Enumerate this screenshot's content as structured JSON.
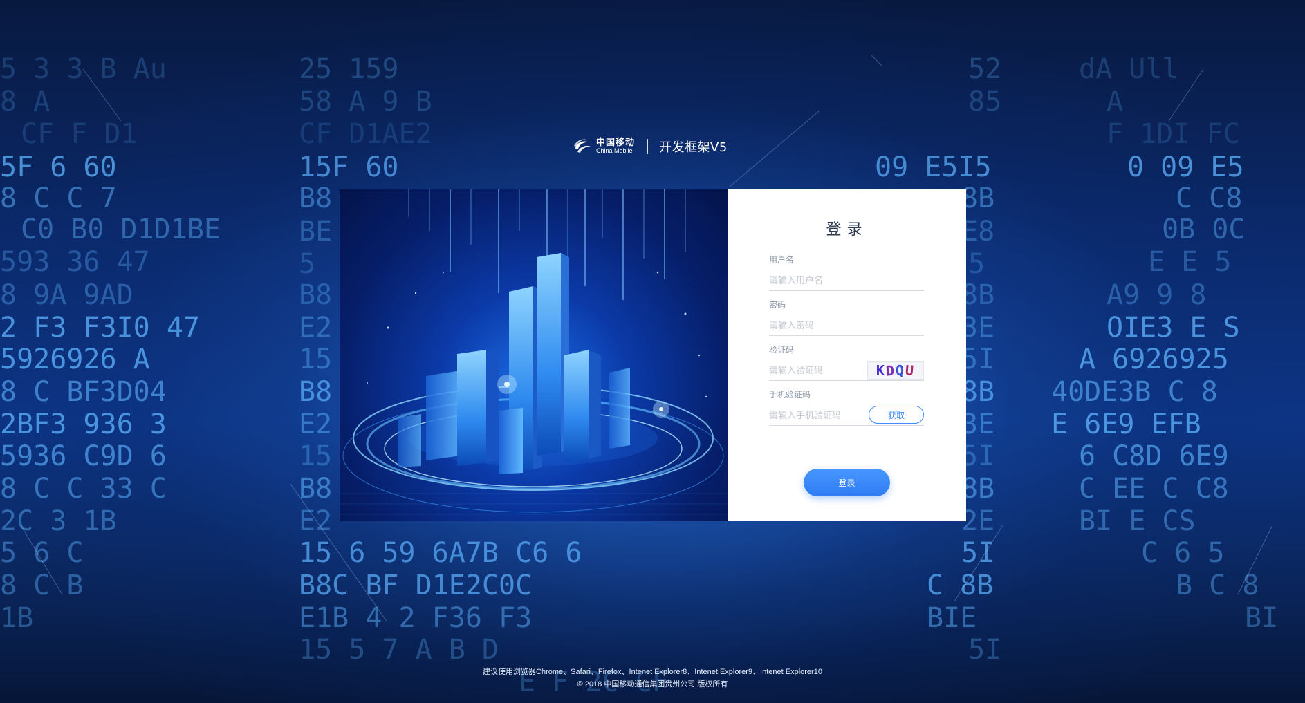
{
  "brand": {
    "company_cn": "中国移动",
    "company_en": "China Mobile",
    "product": "开发框架V5"
  },
  "login": {
    "title": "登录",
    "username": {
      "label": "用户名",
      "placeholder": "请输入用户名",
      "value": ""
    },
    "password": {
      "label": "密码",
      "placeholder": "请输入密码",
      "value": ""
    },
    "captcha": {
      "label": "验证码",
      "placeholder": "请输入验证码",
      "value": "",
      "image_text": [
        "K",
        "D",
        "Q",
        "U"
      ]
    },
    "sms": {
      "label": "手机验证码",
      "placeholder": "请输入手机验证码",
      "value": "",
      "get_button": "获取"
    },
    "submit": "登录"
  },
  "footer": {
    "browsers": "建议使用浏览器Chrome、Safari、Firefox、Intenet Explorer8、Intenet Explorer9、Intenet Explorer10",
    "copyright": "© 2018 中国移动通信集团贵州公司 版权所有"
  },
  "colors": {
    "accent": "#3d8bfd",
    "background": "#0b2a6d"
  },
  "icons": {
    "logo": "china-mobile-logo-icon"
  }
}
